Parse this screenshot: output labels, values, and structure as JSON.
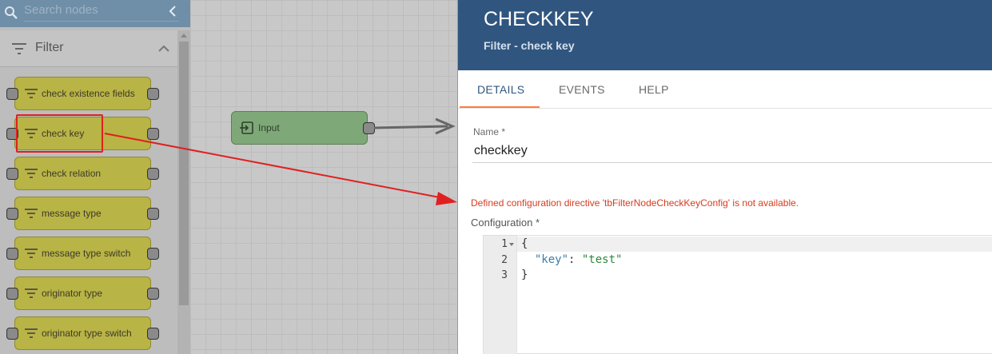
{
  "search": {
    "placeholder": "Search nodes"
  },
  "palette": {
    "group_label": "Filter",
    "nodes": [
      {
        "label": "check existence fields"
      },
      {
        "label": "check key"
      },
      {
        "label": "check relation"
      },
      {
        "label": "message type"
      },
      {
        "label": "message type switch"
      },
      {
        "label": "originator type"
      },
      {
        "label": "originator type switch"
      }
    ]
  },
  "canvas": {
    "input_node_label": "Input"
  },
  "panel": {
    "title": "CHECKKEY",
    "subtitle": "Filter - check key",
    "tabs": [
      {
        "label": "DETAILS",
        "active": true
      },
      {
        "label": "EVENTS",
        "active": false
      },
      {
        "label": "HELP",
        "active": false
      }
    ],
    "name_label": "Name *",
    "name_value": "checkkey",
    "error_message": "Defined configuration directive 'tbFilterNodeCheckKeyConfig' is not available.",
    "config_label": "Configuration *",
    "editor": {
      "line_numbers": [
        "1",
        "2",
        "3"
      ],
      "line1": "{",
      "line2_indent": "  ",
      "line2_key": "\"key\"",
      "line2_colon": ": ",
      "line2_value": "\"test\"",
      "line3": "}"
    }
  },
  "colors": {
    "header_bg": "#305680",
    "tab_ink": "#ff7d3b",
    "filter_node": "#b9b446",
    "input_node": "#7fa878",
    "error": "#d93b1e",
    "annotation_red": "#e02020"
  },
  "icons": {
    "search": "search-icon",
    "collapse": "chevron-left-icon",
    "filter": "filter-icon",
    "group_toggle": "chevron-up-icon",
    "input": "input-icon"
  }
}
